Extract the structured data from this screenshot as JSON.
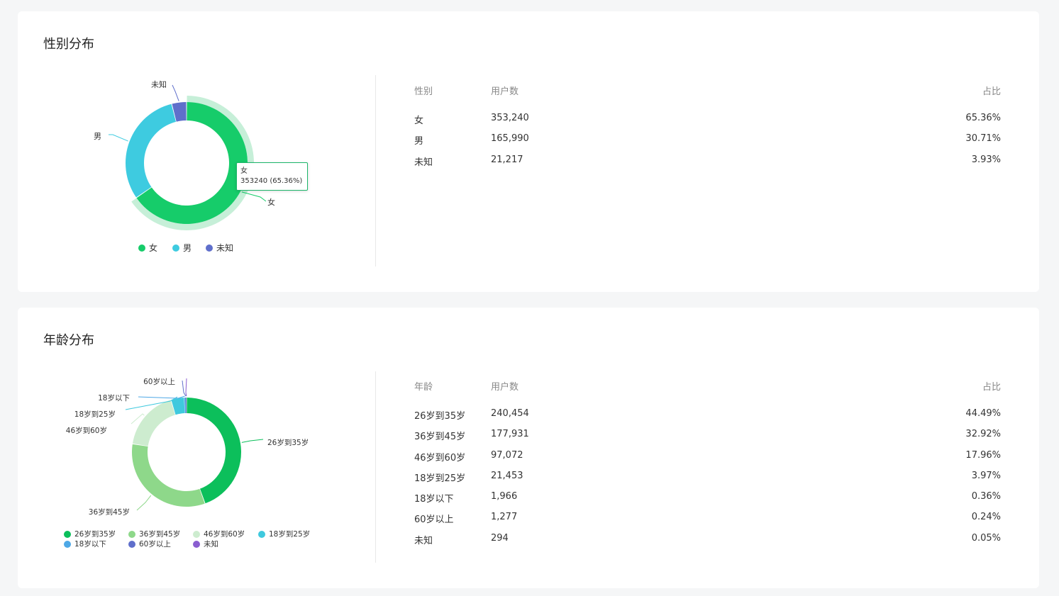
{
  "gender": {
    "title": "性别分布",
    "table": {
      "headers": [
        "性别",
        "用户数",
        "占比"
      ],
      "rows": [
        [
          "女",
          "353,240",
          "65.36%"
        ],
        [
          "男",
          "165,990",
          "30.71%"
        ],
        [
          "未知",
          "21,217",
          "3.93%"
        ]
      ]
    },
    "tooltip": {
      "name": "女",
      "value": "353240 (65.36%)"
    }
  },
  "age": {
    "title": "年龄分布",
    "table": {
      "headers": [
        "年龄",
        "用户数",
        "占比"
      ],
      "rows": [
        [
          "26岁到35岁",
          "240,454",
          "44.49%"
        ],
        [
          "36岁到45岁",
          "177,931",
          "32.92%"
        ],
        [
          "46岁到60岁",
          "97,072",
          "17.96%"
        ],
        [
          "18岁到25岁",
          "21,453",
          "3.97%"
        ],
        [
          "18岁以下",
          "1,966",
          "0.36%"
        ],
        [
          "60岁以上",
          "1,277",
          "0.24%"
        ],
        [
          "未知",
          "294",
          "0.05%"
        ]
      ]
    }
  },
  "chart_data": [
    {
      "type": "pie",
      "categories": [
        "女",
        "男",
        "未知"
      ],
      "values": [
        353240,
        165990,
        21217
      ],
      "colors": [
        "#16cc6a",
        "#3ecbe0",
        "#5f6fcb"
      ],
      "highlight_color": "#c6efd8",
      "highlighted": "女",
      "legend": "bottom"
    },
    {
      "type": "pie",
      "categories": [
        "26岁到35岁",
        "36岁到45岁",
        "46岁到60岁",
        "18岁到25岁",
        "18岁以下",
        "60岁以上",
        "未知"
      ],
      "values": [
        240454,
        177931,
        97072,
        21453,
        1966,
        1277,
        294
      ],
      "colors": [
        "#0cbf5b",
        "#8ed88a",
        "#cdeccf",
        "#3fc9de",
        "#4ea8e6",
        "#5f6fcb",
        "#8a5ed0"
      ],
      "legend": "bottom"
    }
  ]
}
